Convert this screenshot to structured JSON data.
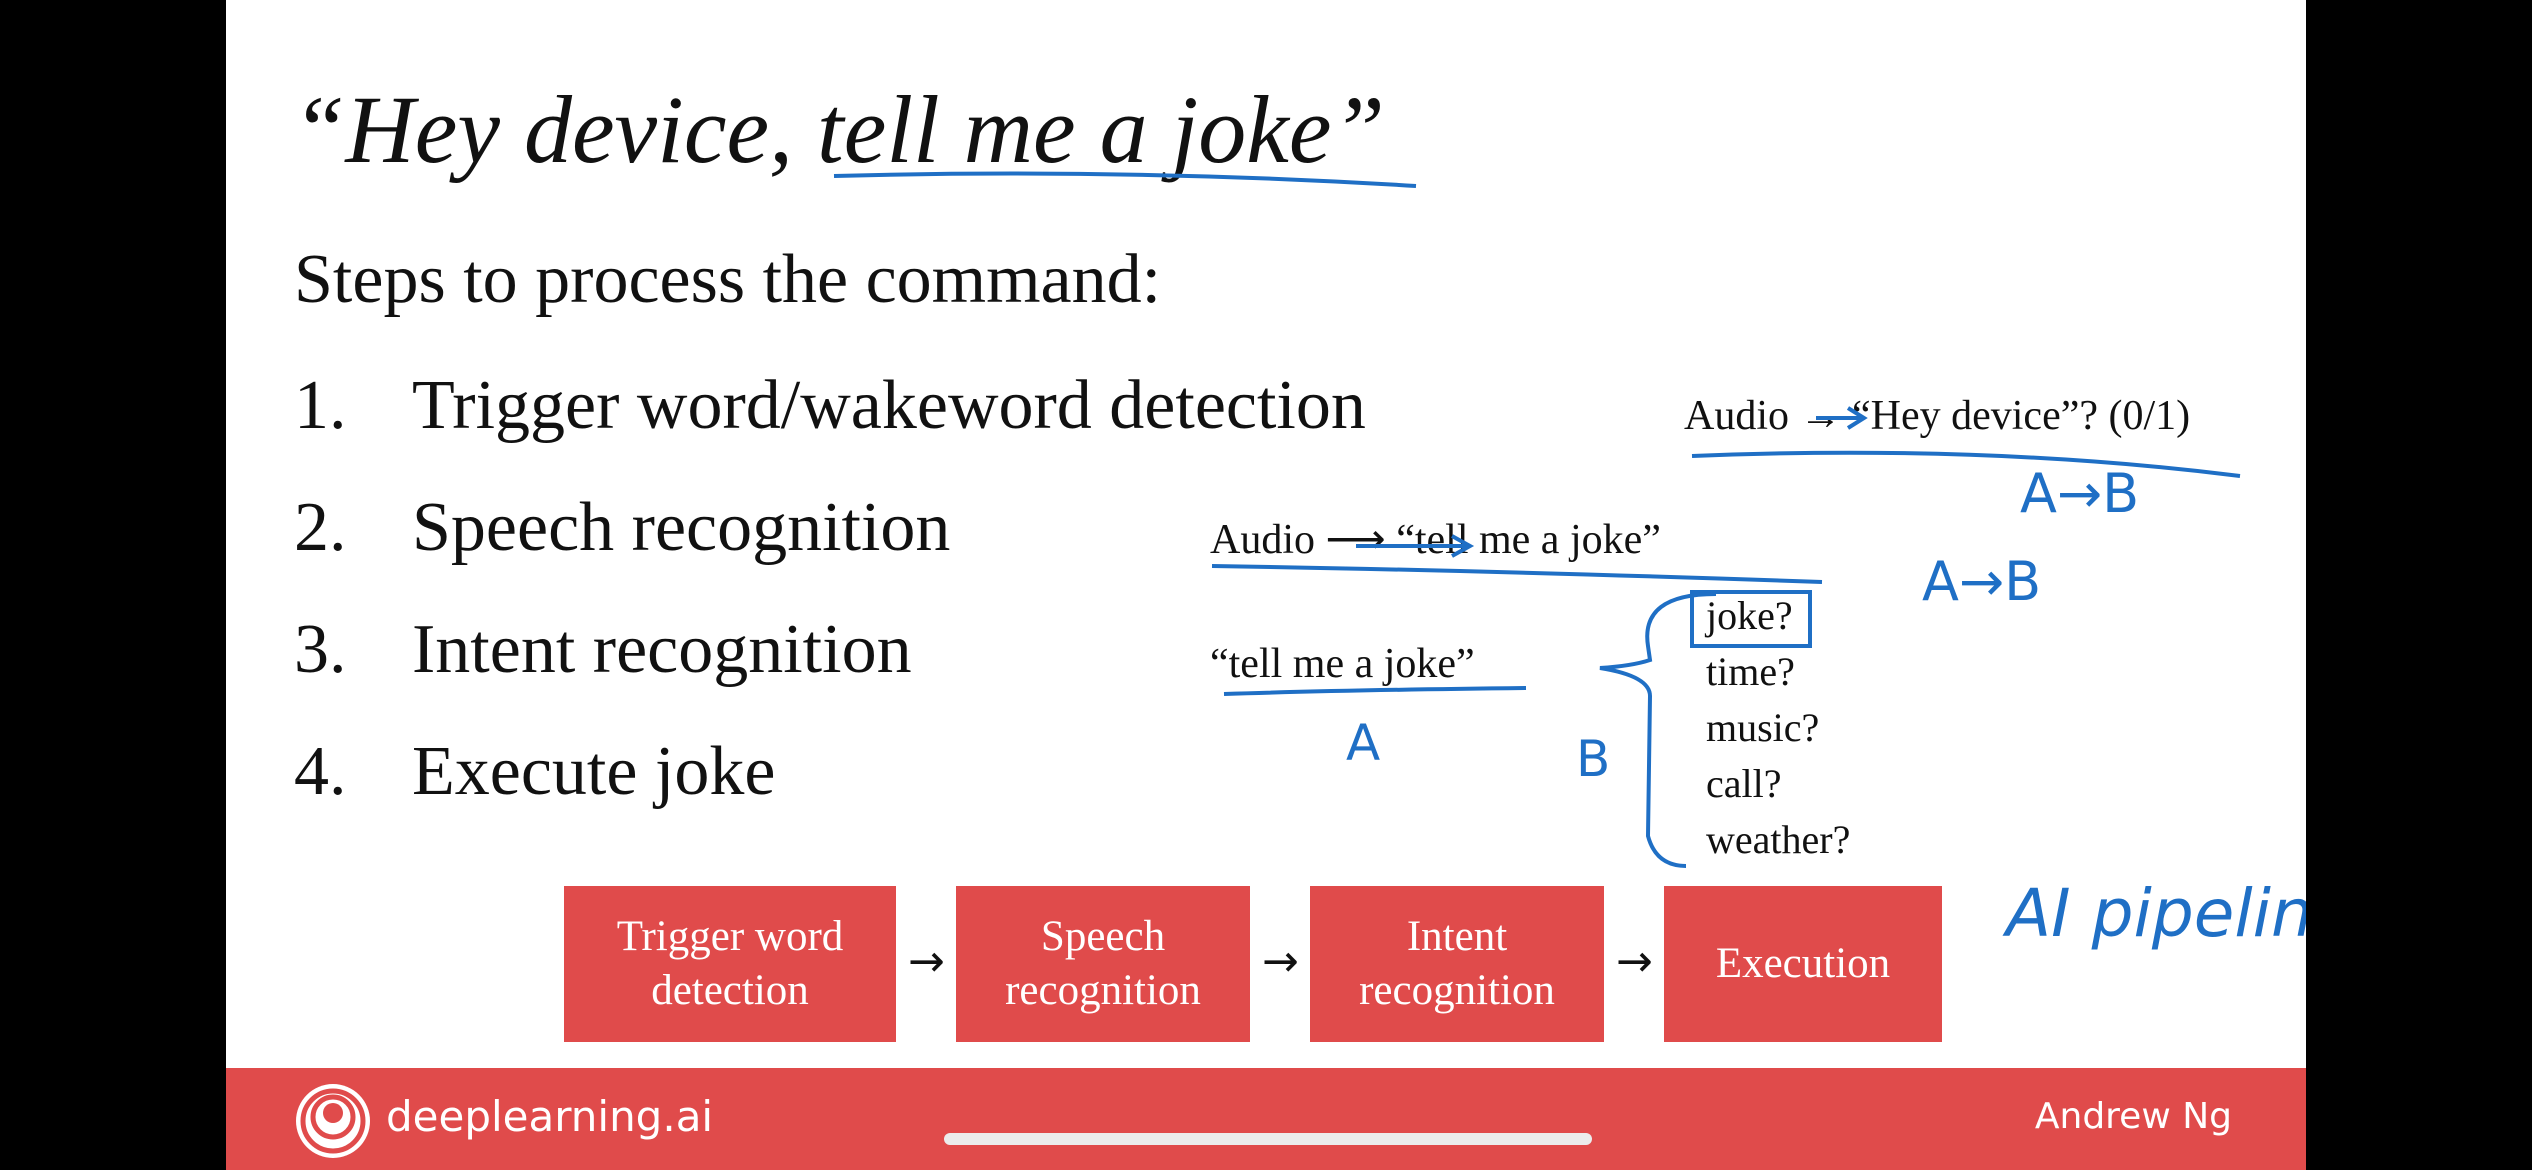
{
  "slide": {
    "title": "“Hey device, tell me a joke”",
    "subtitle": "Steps to process the command:",
    "steps": [
      {
        "num": "1.",
        "text": "Trigger word/wakeword detection"
      },
      {
        "num": "2.",
        "text": "Speech recognition"
      },
      {
        "num": "3.",
        "text": "Intent recognition"
      },
      {
        "num": "4.",
        "text": "Execute joke"
      }
    ],
    "notes": {
      "step1": "Audio → “Hey device”? (0/1)",
      "step2": "Audio ⟶ “tell me a joke”",
      "step3_input": "“tell me a joke”",
      "intents": [
        "joke?",
        "time?",
        "music?",
        "call?",
        "weather?"
      ]
    },
    "pipeline": [
      "Trigger word detection",
      "Speech recognition",
      "Intent recognition",
      "Execution"
    ],
    "pipeline_arrow": "→"
  },
  "handwriting": {
    "a_to_b_1": "A→B",
    "a_to_b_2": "A→B",
    "a_label": "A",
    "b_label": "B",
    "pipeline_note": "AI pipeline"
  },
  "footer": {
    "brand": "deeplearning.ai",
    "author": "Andrew Ng"
  },
  "colors": {
    "accent_red": "#e04b4b",
    "ink_blue": "#1f6fc5",
    "background": "#000000"
  }
}
